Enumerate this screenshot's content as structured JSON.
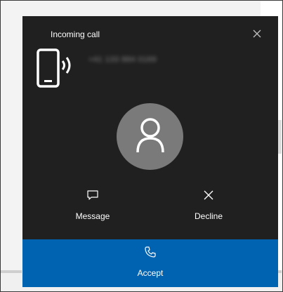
{
  "dialog": {
    "title": "Incoming call",
    "caller_number": "+41 133 884 0169"
  },
  "actions": {
    "message_label": "Message",
    "decline_label": "Decline",
    "accept_label": "Accept"
  },
  "icons": {
    "close": "close-icon",
    "device": "phone-ringing-icon",
    "avatar": "person-icon",
    "message": "chat-bubble-icon",
    "decline": "x-icon",
    "accept": "phone-handset-icon"
  },
  "colors": {
    "dialog_background": "#202020",
    "accept_background": "#0063b1",
    "avatar_background": "#7a7a7a",
    "text": "#ffffff"
  }
}
